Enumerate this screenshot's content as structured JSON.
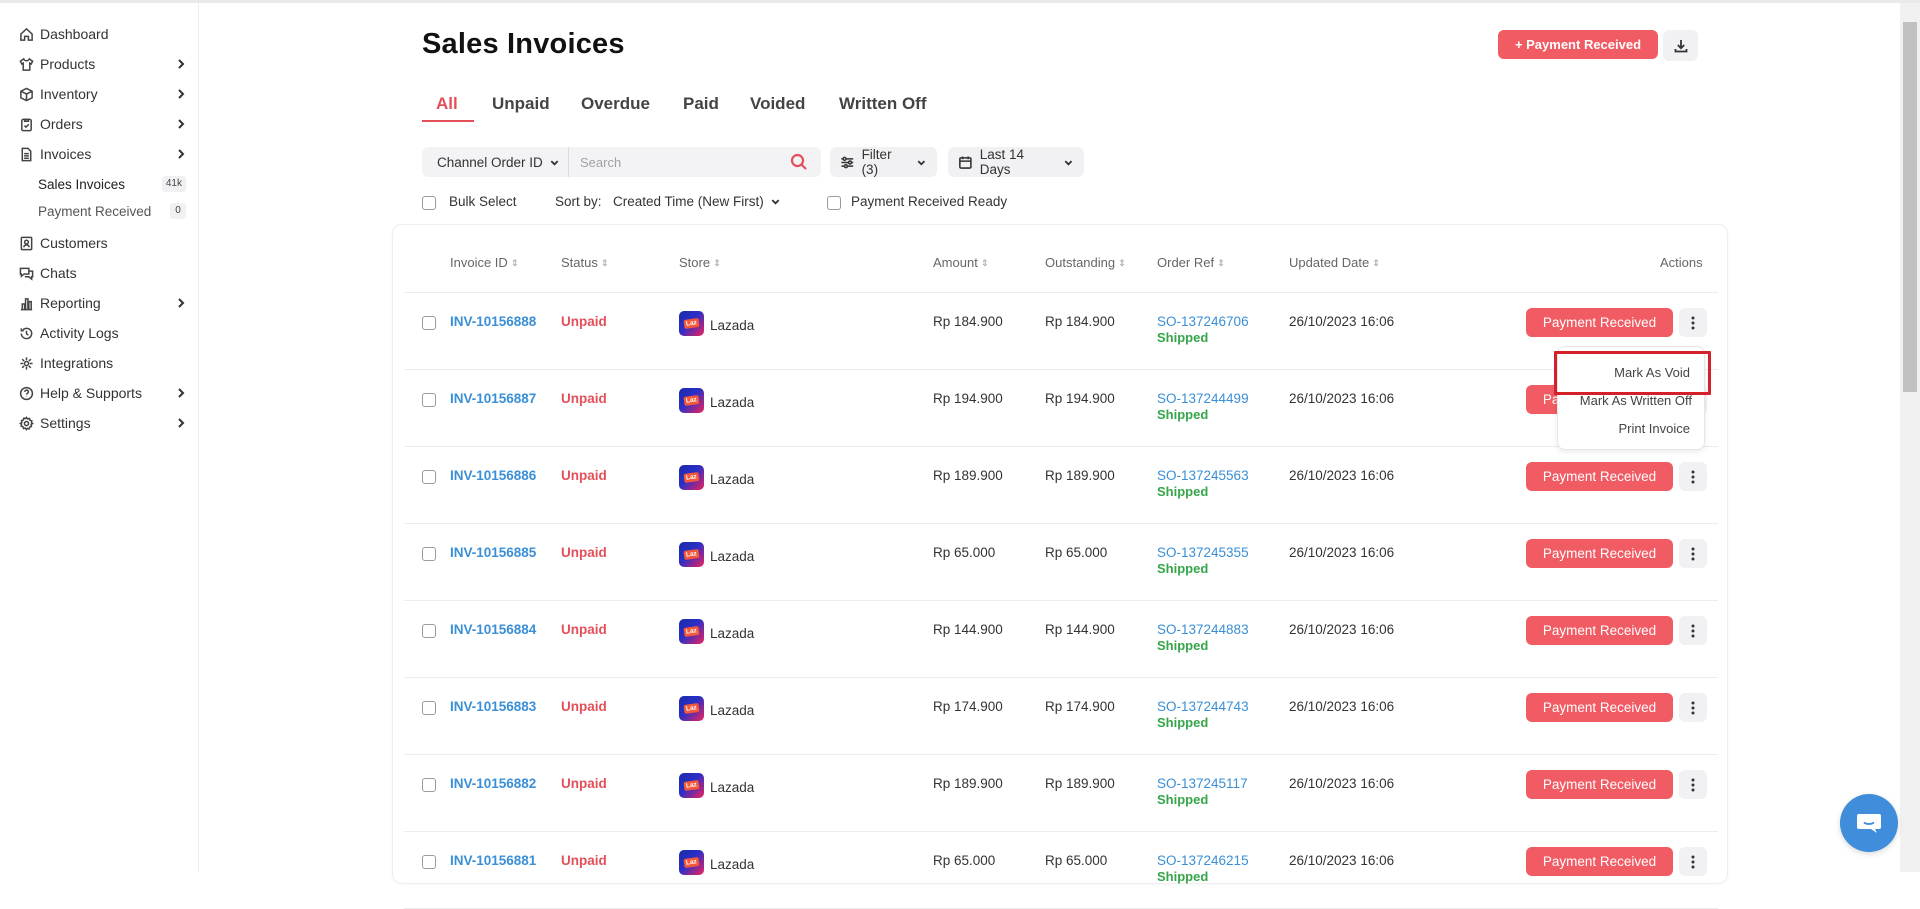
{
  "sidebar": {
    "items": [
      {
        "label": "Dashboard",
        "icon": "home-icon",
        "has_children": false
      },
      {
        "label": "Products",
        "icon": "shirt-icon",
        "has_children": true
      },
      {
        "label": "Inventory",
        "icon": "box-icon",
        "has_children": true
      },
      {
        "label": "Orders",
        "icon": "clipboard-icon",
        "has_children": true
      },
      {
        "label": "Invoices",
        "icon": "document-icon",
        "has_children": true
      },
      {
        "label": "Customers",
        "icon": "contact-icon",
        "has_children": false
      },
      {
        "label": "Chats",
        "icon": "chat-icon",
        "has_children": false
      },
      {
        "label": "Reporting",
        "icon": "bar-chart-icon",
        "has_children": true
      },
      {
        "label": "Activity Logs",
        "icon": "history-icon",
        "has_children": false
      },
      {
        "label": "Integrations",
        "icon": "integration-icon",
        "has_children": false
      },
      {
        "label": "Help & Supports",
        "icon": "help-icon",
        "has_children": true
      },
      {
        "label": "Settings",
        "icon": "gear-icon",
        "has_children": true
      }
    ],
    "sub_items": [
      {
        "label": "Sales Invoices",
        "badge": "41k"
      },
      {
        "label": "Payment Received",
        "badge": "0"
      }
    ]
  },
  "header": {
    "title": "Sales Invoices",
    "payment_button": "+ Payment Received"
  },
  "tabs": [
    "All",
    "Unpaid",
    "Overdue",
    "Paid",
    "Voided",
    "Written Off"
  ],
  "filters": {
    "search_field": "Channel Order ID",
    "search_placeholder": "Search",
    "filter_label": "Filter (3)",
    "date_label": "Last 14 Days",
    "bulk_select": "Bulk Select",
    "sort_by_label": "Sort by:",
    "sort_by_value": "Created Time (New First)",
    "payment_ready": "Payment Received Ready"
  },
  "table": {
    "columns": [
      "Invoice ID",
      "Status",
      "Store",
      "Amount",
      "Outstanding",
      "Order Ref",
      "Updated Date",
      "Actions"
    ],
    "rows": [
      {
        "invoice_id": "INV-10156888",
        "status": "Unpaid",
        "store": "Lazada",
        "amount": "Rp 184.900",
        "outstanding": "Rp 184.900",
        "order_ref": "SO-137246706",
        "order_status": "Shipped",
        "updated": "26/10/2023 16:06",
        "action": "Payment Received"
      },
      {
        "invoice_id": "INV-10156887",
        "status": "Unpaid",
        "store": "Lazada",
        "amount": "Rp 194.900",
        "outstanding": "Rp 194.900",
        "order_ref": "SO-137244499",
        "order_status": "Shipped",
        "updated": "26/10/2023 16:06",
        "action": "Payment Received"
      },
      {
        "invoice_id": "INV-10156886",
        "status": "Unpaid",
        "store": "Lazada",
        "amount": "Rp 189.900",
        "outstanding": "Rp 189.900",
        "order_ref": "SO-137245563",
        "order_status": "Shipped",
        "updated": "26/10/2023 16:06",
        "action": "Payment Received"
      },
      {
        "invoice_id": "INV-10156885",
        "status": "Unpaid",
        "store": "Lazada",
        "amount": "Rp 65.000",
        "outstanding": "Rp 65.000",
        "order_ref": "SO-137245355",
        "order_status": "Shipped",
        "updated": "26/10/2023 16:06",
        "action": "Payment Received"
      },
      {
        "invoice_id": "INV-10156884",
        "status": "Unpaid",
        "store": "Lazada",
        "amount": "Rp 144.900",
        "outstanding": "Rp 144.900",
        "order_ref": "SO-137244883",
        "order_status": "Shipped",
        "updated": "26/10/2023 16:06",
        "action": "Payment Received"
      },
      {
        "invoice_id": "INV-10156883",
        "status": "Unpaid",
        "store": "Lazada",
        "amount": "Rp 174.900",
        "outstanding": "Rp 174.900",
        "order_ref": "SO-137244743",
        "order_status": "Shipped",
        "updated": "26/10/2023 16:06",
        "action": "Payment Received"
      },
      {
        "invoice_id": "INV-10156882",
        "status": "Unpaid",
        "store": "Lazada",
        "amount": "Rp 189.900",
        "outstanding": "Rp 189.900",
        "order_ref": "SO-137245117",
        "order_status": "Shipped",
        "updated": "26/10/2023 16:06",
        "action": "Payment Received"
      },
      {
        "invoice_id": "INV-10156881",
        "status": "Unpaid",
        "store": "Lazada",
        "amount": "Rp 65.000",
        "outstanding": "Rp 65.000",
        "order_ref": "SO-137246215",
        "order_status": "Shipped",
        "updated": "26/10/2023 16:06",
        "action": "Payment Received"
      }
    ]
  },
  "store_logo_text": "Laz",
  "menu": {
    "items": [
      "Mark As Void",
      "Mark As Written Off",
      "Print Invoice"
    ]
  },
  "colors": {
    "accent": "#f15b63",
    "link": "#3a8fd6",
    "shipped": "#35a64a",
    "highlight": "#d3202a"
  }
}
